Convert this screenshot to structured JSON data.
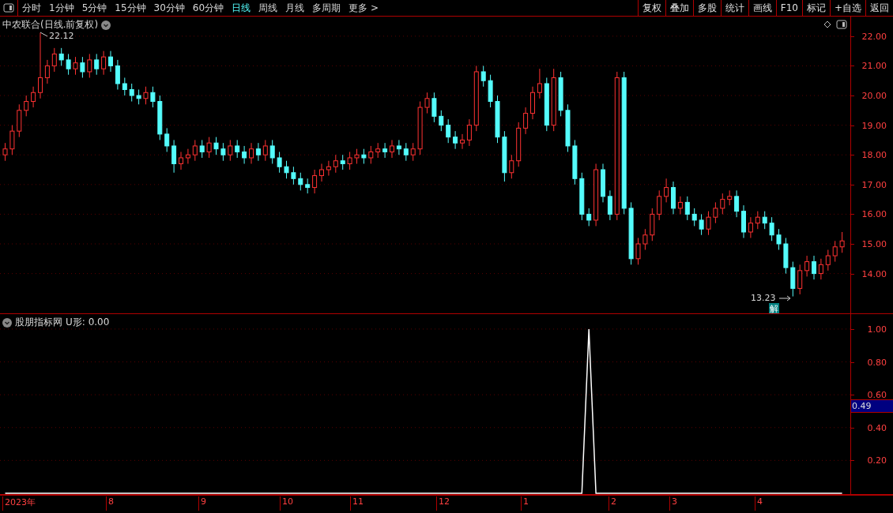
{
  "toolbar": {
    "periods": [
      {
        "label": "分时",
        "selected": false
      },
      {
        "label": "1分钟",
        "selected": false
      },
      {
        "label": "5分钟",
        "selected": false
      },
      {
        "label": "15分钟",
        "selected": false
      },
      {
        "label": "30分钟",
        "selected": false
      },
      {
        "label": "60分钟",
        "selected": false
      },
      {
        "label": "日线",
        "selected": true
      },
      {
        "label": "周线",
        "selected": false
      },
      {
        "label": "月线",
        "selected": false
      },
      {
        "label": "多周期",
        "selected": false
      },
      {
        "label": "更多 >",
        "selected": false
      }
    ],
    "actions": [
      "复权",
      "叠加",
      "多股",
      "统计",
      "画线",
      "F10",
      "标记",
      "+自选",
      "返回"
    ]
  },
  "price_panel": {
    "title": "中农联合(日线.前复权)",
    "high_label": "22.12",
    "low_label": "13.23",
    "badge": "解",
    "chart_data": {
      "type": "candlestick",
      "grid": true,
      "ylim": [
        12.66,
        22.66
      ],
      "yticks": [
        {
          "value": 22,
          "label": "22.00"
        },
        {
          "value": 21,
          "label": "21.00"
        },
        {
          "value": 20,
          "label": "20.00"
        },
        {
          "value": 19,
          "label": "19.00"
        },
        {
          "value": 18,
          "label": "18.00"
        },
        {
          "value": 17,
          "label": "17.00"
        },
        {
          "value": 16,
          "label": "16.00"
        },
        {
          "value": 15,
          "label": "15.00"
        },
        {
          "value": 14,
          "label": "14.00"
        }
      ],
      "ohlc": [
        [
          18.0,
          18.4,
          17.8,
          18.2
        ],
        [
          18.2,
          19.0,
          18.0,
          18.8
        ],
        [
          18.8,
          19.7,
          18.6,
          19.5
        ],
        [
          19.5,
          20.0,
          19.3,
          19.8
        ],
        [
          19.8,
          20.3,
          19.6,
          20.1
        ],
        [
          20.1,
          22.12,
          19.9,
          20.6
        ],
        [
          20.6,
          21.2,
          20.4,
          21.0
        ],
        [
          21.0,
          21.6,
          20.8,
          21.4
        ],
        [
          21.4,
          21.6,
          21.0,
          21.2
        ],
        [
          21.2,
          21.4,
          20.7,
          20.9
        ],
        [
          20.9,
          21.3,
          20.7,
          21.1
        ],
        [
          21.1,
          21.3,
          20.6,
          20.8
        ],
        [
          20.8,
          21.4,
          20.6,
          21.2
        ],
        [
          21.2,
          21.4,
          20.7,
          20.9
        ],
        [
          20.9,
          21.5,
          20.7,
          21.3
        ],
        [
          21.3,
          21.5,
          20.8,
          21.0
        ],
        [
          21.0,
          21.2,
          20.2,
          20.4
        ],
        [
          20.4,
          20.6,
          20.0,
          20.2
        ],
        [
          20.2,
          20.4,
          19.8,
          20.0
        ],
        [
          20.0,
          20.2,
          19.7,
          19.9
        ],
        [
          19.9,
          20.3,
          19.7,
          20.1
        ],
        [
          20.1,
          20.3,
          19.6,
          19.8
        ],
        [
          19.8,
          20.0,
          18.5,
          18.7
        ],
        [
          18.7,
          18.9,
          18.1,
          18.3
        ],
        [
          18.3,
          18.5,
          17.4,
          17.7
        ],
        [
          17.7,
          18.1,
          17.5,
          17.9
        ],
        [
          17.9,
          18.2,
          17.7,
          18.0
        ],
        [
          18.0,
          18.5,
          17.8,
          18.3
        ],
        [
          18.3,
          18.5,
          17.9,
          18.1
        ],
        [
          18.1,
          18.6,
          17.9,
          18.4
        ],
        [
          18.4,
          18.6,
          18.0,
          18.2
        ],
        [
          18.2,
          18.4,
          17.8,
          18.0
        ],
        [
          18.0,
          18.5,
          17.8,
          18.3
        ],
        [
          18.3,
          18.5,
          17.9,
          18.1
        ],
        [
          18.1,
          18.3,
          17.7,
          17.9
        ],
        [
          17.9,
          18.4,
          17.7,
          18.2
        ],
        [
          18.2,
          18.4,
          17.8,
          18.0
        ],
        [
          18.0,
          18.5,
          17.8,
          18.3
        ],
        [
          18.3,
          18.5,
          17.7,
          17.9
        ],
        [
          17.9,
          18.1,
          17.4,
          17.6
        ],
        [
          17.6,
          17.8,
          17.2,
          17.4
        ],
        [
          17.4,
          17.6,
          17.0,
          17.2
        ],
        [
          17.2,
          17.4,
          16.8,
          17.0
        ],
        [
          17.0,
          17.2,
          16.7,
          16.9
        ],
        [
          16.9,
          17.5,
          16.7,
          17.3
        ],
        [
          17.3,
          17.7,
          17.1,
          17.5
        ],
        [
          17.5,
          17.8,
          17.3,
          17.6
        ],
        [
          17.6,
          18.0,
          17.4,
          17.8
        ],
        [
          17.8,
          18.0,
          17.5,
          17.7
        ],
        [
          17.7,
          18.1,
          17.5,
          17.9
        ],
        [
          17.9,
          18.2,
          17.7,
          18.0
        ],
        [
          18.0,
          18.2,
          17.7,
          17.9
        ],
        [
          17.9,
          18.3,
          17.7,
          18.1
        ],
        [
          18.1,
          18.4,
          17.9,
          18.2
        ],
        [
          18.2,
          18.4,
          17.9,
          18.1
        ],
        [
          18.1,
          18.5,
          17.9,
          18.3
        ],
        [
          18.3,
          18.5,
          18.0,
          18.2
        ],
        [
          18.2,
          18.4,
          17.8,
          18.0
        ],
        [
          18.0,
          18.4,
          17.8,
          18.2
        ],
        [
          18.2,
          19.8,
          18.0,
          19.6
        ],
        [
          19.6,
          20.1,
          19.4,
          19.9
        ],
        [
          19.9,
          20.1,
          19.1,
          19.3
        ],
        [
          19.3,
          19.5,
          18.8,
          19.0
        ],
        [
          19.0,
          19.2,
          18.4,
          18.6
        ],
        [
          18.6,
          18.8,
          18.2,
          18.4
        ],
        [
          18.4,
          18.7,
          18.2,
          18.5
        ],
        [
          18.5,
          19.2,
          18.3,
          19.0
        ],
        [
          19.0,
          21.0,
          18.8,
          20.8
        ],
        [
          20.8,
          21.0,
          20.3,
          20.5
        ],
        [
          20.5,
          20.7,
          19.6,
          19.8
        ],
        [
          19.8,
          20.0,
          18.4,
          18.6
        ],
        [
          18.6,
          18.8,
          17.1,
          17.4
        ],
        [
          17.4,
          18.0,
          17.2,
          17.8
        ],
        [
          17.8,
          19.1,
          17.6,
          18.9
        ],
        [
          18.9,
          19.6,
          18.7,
          19.4
        ],
        [
          19.4,
          20.3,
          19.2,
          20.1
        ],
        [
          20.1,
          20.9,
          19.9,
          20.4
        ],
        [
          20.4,
          20.6,
          18.8,
          19.0
        ],
        [
          19.0,
          20.9,
          18.8,
          20.6
        ],
        [
          20.6,
          20.8,
          19.3,
          19.5
        ],
        [
          19.5,
          19.7,
          18.1,
          18.3
        ],
        [
          18.3,
          18.5,
          17.0,
          17.2
        ],
        [
          17.2,
          17.4,
          15.8,
          16.0
        ],
        [
          16.0,
          16.2,
          15.6,
          15.8
        ],
        [
          15.8,
          17.7,
          15.6,
          17.5
        ],
        [
          17.5,
          17.7,
          16.4,
          16.6
        ],
        [
          16.6,
          16.8,
          15.8,
          16.0
        ],
        [
          16.0,
          20.8,
          15.8,
          20.6
        ],
        [
          20.6,
          20.8,
          16.0,
          16.2
        ],
        [
          16.2,
          16.4,
          14.3,
          14.5
        ],
        [
          14.5,
          15.2,
          14.3,
          15.0
        ],
        [
          15.0,
          15.5,
          14.8,
          15.3
        ],
        [
          15.3,
          16.2,
          15.1,
          16.0
        ],
        [
          16.0,
          16.8,
          15.8,
          16.6
        ],
        [
          16.6,
          17.2,
          16.4,
          16.9
        ],
        [
          16.9,
          17.1,
          16.0,
          16.2
        ],
        [
          16.2,
          16.6,
          16.0,
          16.4
        ],
        [
          16.4,
          16.6,
          15.8,
          16.0
        ],
        [
          16.0,
          16.2,
          15.6,
          15.8
        ],
        [
          15.8,
          16.0,
          15.3,
          15.5
        ],
        [
          15.5,
          16.1,
          15.3,
          15.9
        ],
        [
          15.9,
          16.4,
          15.7,
          16.2
        ],
        [
          16.2,
          16.7,
          16.0,
          16.5
        ],
        [
          16.5,
          16.8,
          16.3,
          16.6
        ],
        [
          16.6,
          16.8,
          15.9,
          16.1
        ],
        [
          16.1,
          16.3,
          15.2,
          15.4
        ],
        [
          15.4,
          15.9,
          15.2,
          15.7
        ],
        [
          15.7,
          16.1,
          15.5,
          15.9
        ],
        [
          15.9,
          16.1,
          15.5,
          15.7
        ],
        [
          15.7,
          15.9,
          15.1,
          15.3
        ],
        [
          15.3,
          15.5,
          14.8,
          15.0
        ],
        [
          15.0,
          15.2,
          14.0,
          14.2
        ],
        [
          14.2,
          14.4,
          13.23,
          13.5
        ],
        [
          13.5,
          14.3,
          13.3,
          14.1
        ],
        [
          14.1,
          14.6,
          13.9,
          14.4
        ],
        [
          14.4,
          14.6,
          13.8,
          14.0
        ],
        [
          14.0,
          14.5,
          13.8,
          14.3
        ],
        [
          14.3,
          14.8,
          14.1,
          14.6
        ],
        [
          14.6,
          15.1,
          14.4,
          14.9
        ],
        [
          14.9,
          15.4,
          14.7,
          15.1
        ]
      ]
    }
  },
  "indicator_panel": {
    "title": "股朋指标网",
    "formula": "U形: 0.00",
    "current_value": "0.49",
    "chart_data": {
      "type": "line",
      "grid": true,
      "ylim": [
        -0.005,
        1.091
      ],
      "yticks": [
        {
          "value": 1,
          "label": "1.00"
        },
        {
          "value": 0.8,
          "label": "0.80"
        },
        {
          "value": 0.6,
          "label": "0.60"
        },
        {
          "value": 0.4,
          "label": "0.40"
        },
        {
          "value": 0.2,
          "label": "0.20"
        }
      ],
      "series": [
        {
          "color": "#ffffff",
          "values": [
            0,
            0,
            0,
            0,
            0,
            0,
            0,
            0,
            0,
            0,
            0,
            0,
            0,
            0,
            0,
            0,
            0,
            0,
            0,
            0,
            0,
            0,
            0,
            0,
            0,
            0,
            0,
            0,
            0,
            0,
            0,
            0,
            0,
            0,
            0,
            0,
            0,
            0,
            0,
            0,
            0,
            0,
            0,
            0,
            0,
            0,
            0,
            0,
            0,
            0,
            0,
            0,
            0,
            0,
            0,
            0,
            0,
            0,
            0,
            0,
            0,
            0,
            0,
            0,
            0,
            0,
            0,
            0,
            0,
            0,
            0,
            0,
            0,
            0,
            0,
            0,
            0,
            0,
            0,
            0,
            0,
            0,
            0,
            1,
            0,
            0,
            0,
            0,
            0,
            0,
            0,
            0,
            0,
            0,
            0,
            0,
            0,
            0,
            0,
            0,
            0,
            0,
            0,
            0,
            0,
            0,
            0,
            0,
            0,
            0,
            0,
            0,
            0,
            0,
            0,
            0,
            0,
            0,
            0,
            0
          ]
        }
      ]
    }
  },
  "date_axis": [
    "2023年",
    "8",
    "9",
    "10",
    "11",
    "12",
    "1",
    "2",
    "3",
    "4"
  ]
}
